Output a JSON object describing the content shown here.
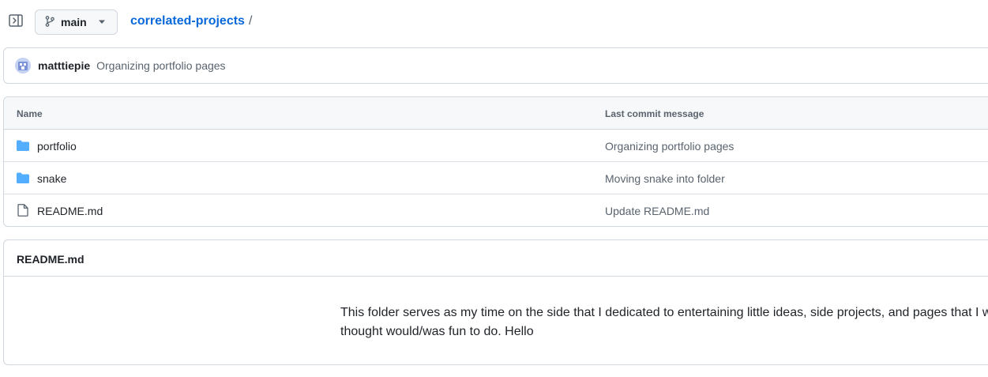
{
  "header": {
    "branch": "main",
    "breadcrumb": {
      "repo": "correlated-projects",
      "separator": "/"
    }
  },
  "commit": {
    "author": "matttiepie",
    "message": "Organizing portfolio pages"
  },
  "file_table": {
    "columns": {
      "name": "Name",
      "last_commit": "Last commit message"
    },
    "rows": [
      {
        "type": "folder",
        "name": "portfolio",
        "message": "Organizing portfolio pages"
      },
      {
        "type": "folder",
        "name": "snake",
        "message": "Moving snake into folder"
      },
      {
        "type": "file",
        "name": "README.md",
        "message": "Update README.md"
      }
    ]
  },
  "readme": {
    "title": "README.md",
    "line1": "This folder serves as my time on the side that I dedicated to entertaining little ideas, side projects, and pages that I w",
    "line2": "thought would/was fun to do. Hello"
  },
  "colors": {
    "link": "#0969da",
    "folder": "#54aeff",
    "muted": "#59636e",
    "border": "#d0d7de"
  },
  "icons": {
    "sidebar_toggle": "sidebar-expand-icon",
    "branch": "git-branch-icon",
    "caret": "triangle-down-icon",
    "folder": "folder-icon",
    "file": "file-icon"
  }
}
